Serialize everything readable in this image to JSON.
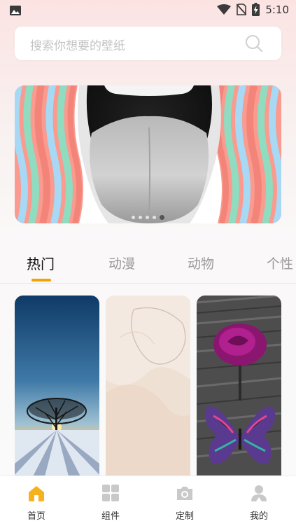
{
  "status_bar": {
    "time": "5:10",
    "icons": [
      "image-icon",
      "wifi-icon",
      "no-sim-icon",
      "battery-charging-icon"
    ]
  },
  "search": {
    "placeholder": "搜索你想要的壁纸",
    "icon": "search-icon"
  },
  "banner": {
    "slide_count": 5,
    "active_slide": 4
  },
  "tabs": [
    {
      "label": "热门",
      "active": true
    },
    {
      "label": "动漫",
      "active": false
    },
    {
      "label": "动物",
      "active": false
    },
    {
      "label": "个性",
      "active": false
    }
  ],
  "wallpapers": [
    {
      "name": "tree-sunset-wallpaper"
    },
    {
      "name": "beige-abstract-wallpaper"
    },
    {
      "name": "rose-butterfly-wallpaper"
    }
  ],
  "bottom_nav": [
    {
      "label": "首页",
      "icon": "home-icon",
      "active": true
    },
    {
      "label": "组件",
      "icon": "widgets-icon",
      "active": false
    },
    {
      "label": "定制",
      "icon": "camera-icon",
      "active": false
    },
    {
      "label": "我的",
      "icon": "profile-icon",
      "active": false
    }
  ],
  "colors": {
    "accent": "#f5a300",
    "active_tab": "#111111",
    "inactive_tab": "#9a9a9a"
  }
}
